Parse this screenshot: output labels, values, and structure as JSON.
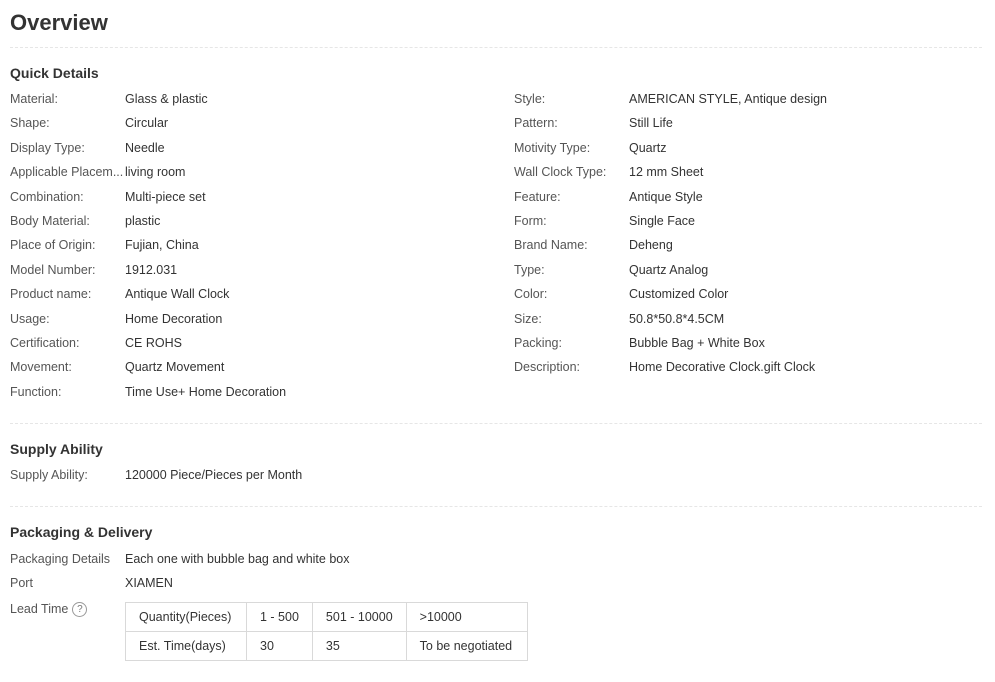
{
  "overview": {
    "title": "Overview"
  },
  "quick_details": {
    "title": "Quick Details",
    "left": [
      {
        "label": "Material:",
        "value": "Glass & plastic"
      },
      {
        "label": "Shape:",
        "value": "Circular"
      },
      {
        "label": "Display Type:",
        "value": "Needle"
      },
      {
        "label": "Applicable Placem...",
        "value": "living room"
      },
      {
        "label": "Combination:",
        "value": "Multi-piece set"
      },
      {
        "label": "Body Material:",
        "value": "plastic"
      },
      {
        "label": "Place of Origin:",
        "value": "Fujian, China"
      },
      {
        "label": "Model Number:",
        "value": "1912.031"
      },
      {
        "label": "Product name:",
        "value": "Antique Wall Clock"
      },
      {
        "label": "Usage:",
        "value": "Home Decoration"
      },
      {
        "label": "Certification:",
        "value": "CE ROHS"
      },
      {
        "label": "Movement:",
        "value": "Quartz Movement"
      },
      {
        "label": "Function:",
        "value": "Time Use+ Home Decoration"
      }
    ],
    "right": [
      {
        "label": "Style:",
        "value": "AMERICAN STYLE, Antique design"
      },
      {
        "label": "Pattern:",
        "value": "Still Life"
      },
      {
        "label": "Motivity Type:",
        "value": "Quartz"
      },
      {
        "label": "Wall Clock Type:",
        "value": "12 mm Sheet"
      },
      {
        "label": "Feature:",
        "value": "Antique Style"
      },
      {
        "label": "Form:",
        "value": "Single Face"
      },
      {
        "label": "Brand Name:",
        "value": "Deheng"
      },
      {
        "label": "Type:",
        "value": "Quartz Analog"
      },
      {
        "label": "Color:",
        "value": "Customized Color"
      },
      {
        "label": "Size:",
        "value": "50.8*50.8*4.5CM"
      },
      {
        "label": "Packing:",
        "value": "Bubble Bag + White Box"
      },
      {
        "label": "Description:",
        "value": "Home Decorative Clock.gift Clock"
      }
    ]
  },
  "supply_ability": {
    "title": "Supply Ability",
    "label": "Supply Ability:",
    "value": "120000 Piece/Pieces per Month"
  },
  "packaging_delivery": {
    "title": "Packaging & Delivery",
    "packaging_details_label": "Packaging Details",
    "packaging_details_value": "Each one with bubble bag and white box",
    "port_label": "Port",
    "port_value": "XIAMEN",
    "lead_time_label": "Lead Time",
    "lead_time_icon": "question-circle-icon",
    "lead_table": {
      "rows": [
        [
          "Quantity(Pieces)",
          "1 - 500",
          "501 - 10000",
          ">10000"
        ],
        [
          "Est. Time(days)",
          "30",
          "35",
          "To be negotiated"
        ]
      ]
    }
  }
}
